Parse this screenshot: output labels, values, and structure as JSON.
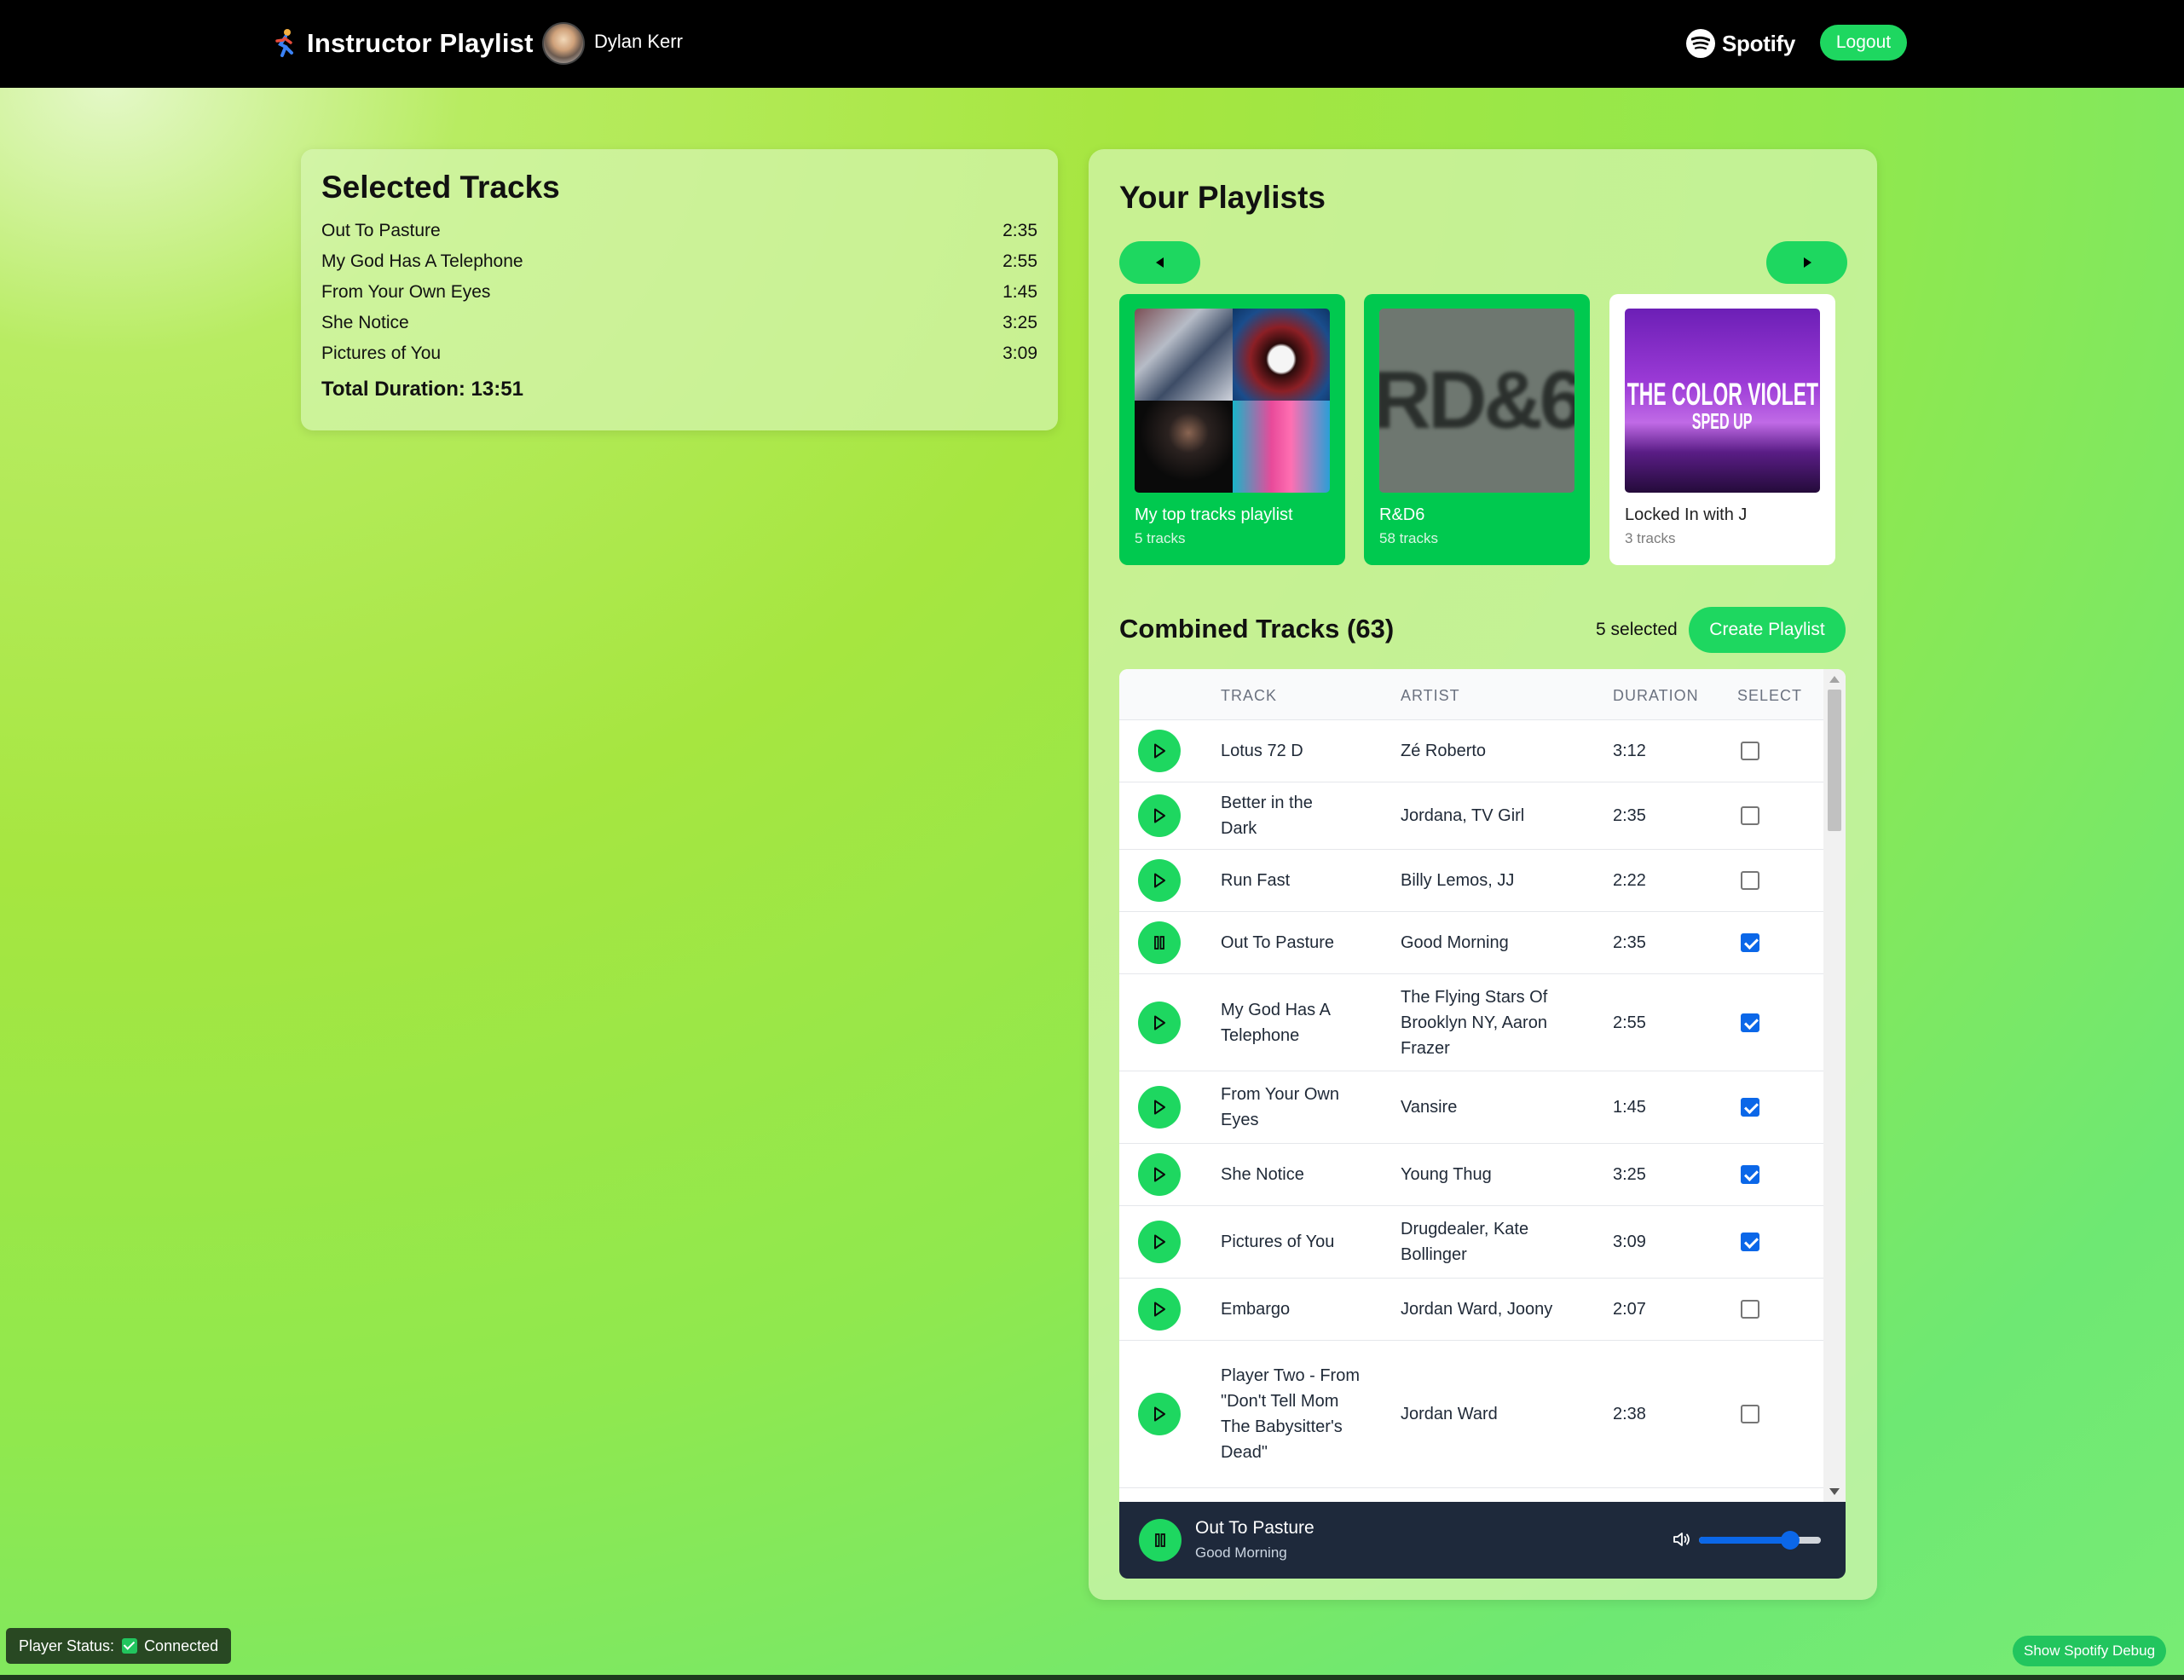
{
  "header": {
    "app_title": "Instructor Playlist",
    "user_name": "Dylan Kerr",
    "spotify_wordmark": "Spotify",
    "logout_label": "Logout"
  },
  "selected_tracks": {
    "title": "Selected Tracks",
    "items": [
      {
        "name": "Out To Pasture",
        "duration": "2:35"
      },
      {
        "name": "My God Has A Telephone",
        "duration": "2:55"
      },
      {
        "name": "From Your Own Eyes",
        "duration": "1:45"
      },
      {
        "name": "She Notice",
        "duration": "3:25"
      },
      {
        "name": "Pictures of You",
        "duration": "3:09"
      }
    ],
    "total_label": "Total Duration: 13:51"
  },
  "playlists": {
    "title": "Your Playlists",
    "items": [
      {
        "name": "My top tracks playlist",
        "count": "5 tracks",
        "selected": true
      },
      {
        "name": "R&D6",
        "count": "58 tracks",
        "selected": true,
        "art_text": "RD&6"
      },
      {
        "name": "Locked In with J",
        "count": "3 tracks",
        "selected": false,
        "art_line1": "THE COLOR VIOLET",
        "art_line2": "SPED UP"
      }
    ]
  },
  "combined": {
    "title": "Combined Tracks (63)",
    "selected_count": "5 selected",
    "create_label": "Create Playlist",
    "columns": [
      "TRACK",
      "ARTIST",
      "DURATION",
      "SELECT"
    ],
    "rows": [
      {
        "track": "Lotus 72 D",
        "artist": "Zé Roberto",
        "duration": "3:12",
        "checked": false,
        "playing": false
      },
      {
        "track": "Better in the Dark",
        "artist": "Jordana, TV Girl",
        "duration": "2:35",
        "checked": false,
        "playing": false
      },
      {
        "track": "Run Fast",
        "artist": "Billy Lemos, JJ",
        "duration": "2:22",
        "checked": false,
        "playing": false
      },
      {
        "track": "Out To Pasture",
        "artist": "Good Morning",
        "duration": "2:35",
        "checked": true,
        "playing": true
      },
      {
        "track": "My God Has A Telephone",
        "artist": "The Flying Stars Of Brooklyn NY, Aaron Frazer",
        "duration": "2:55",
        "checked": true,
        "playing": false
      },
      {
        "track": "From Your Own Eyes",
        "artist": "Vansire",
        "duration": "1:45",
        "checked": true,
        "playing": false
      },
      {
        "track": "She Notice",
        "artist": "Young Thug",
        "duration": "3:25",
        "checked": true,
        "playing": false
      },
      {
        "track": "Pictures of You",
        "artist": "Drugdealer, Kate Bollinger",
        "duration": "3:09",
        "checked": true,
        "playing": false
      },
      {
        "track": "Embargo",
        "artist": "Jordan Ward, Joony",
        "duration": "2:07",
        "checked": false,
        "playing": false
      },
      {
        "track": "Player Two - From \"Don't Tell Mom The Babysitter's Dead\"",
        "artist": "Jordan Ward",
        "duration": "2:38",
        "checked": false,
        "playing": false
      }
    ]
  },
  "player": {
    "title": "Out To Pasture",
    "artist": "Good Morning",
    "volume": 0.75
  },
  "status": {
    "label": "Player Status:",
    "value": "Connected"
  },
  "debug_label": "Show Spotify Debug",
  "colors": {
    "accent": "#1ed760",
    "card_selected": "#00c94f",
    "checkbox": "#0b67e8",
    "player_bg": "#1e293b"
  }
}
